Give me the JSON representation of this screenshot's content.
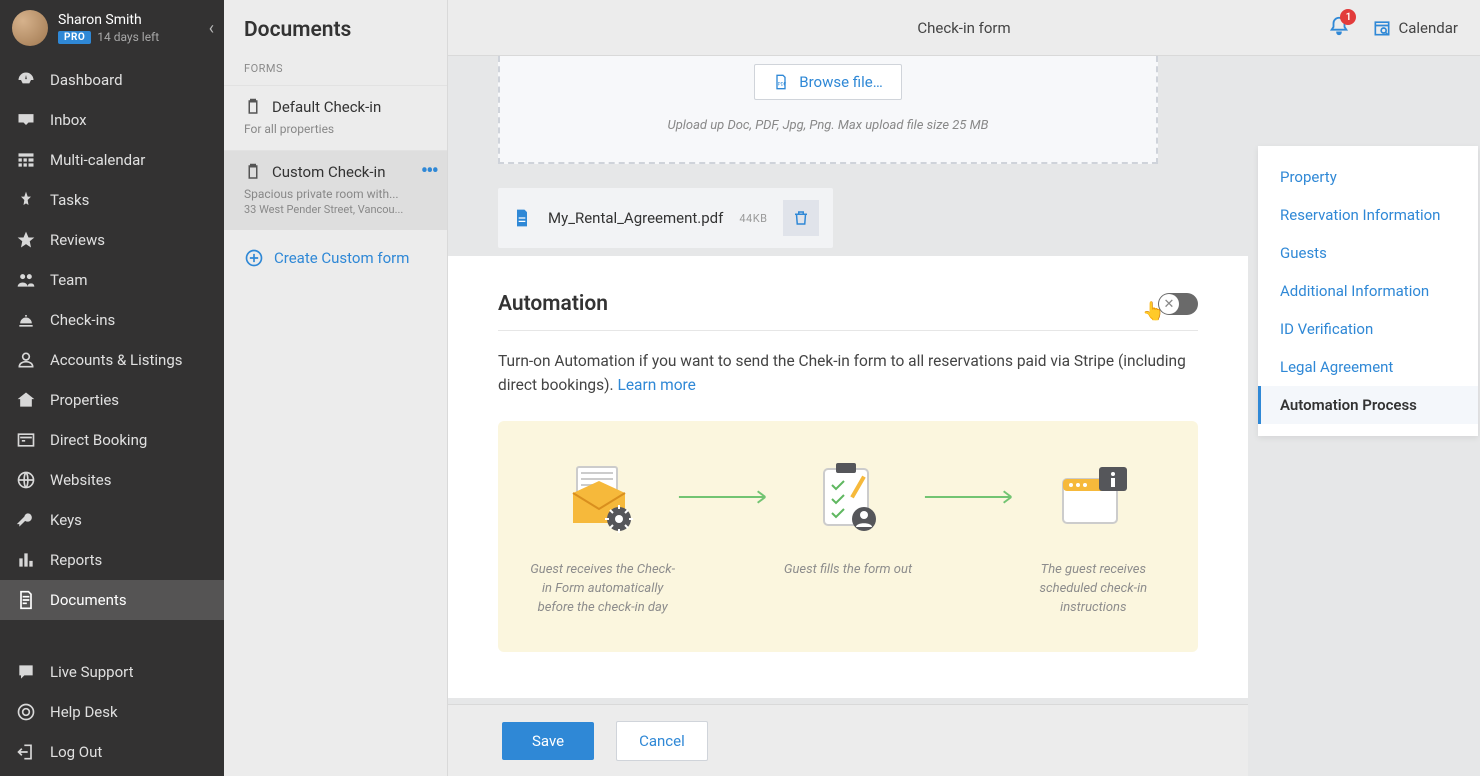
{
  "user": {
    "name": "Sharon Smith",
    "badge": "PRO",
    "days_left": "14 days left"
  },
  "nav": [
    {
      "label": "Dashboard"
    },
    {
      "label": "Inbox"
    },
    {
      "label": "Multi-calendar"
    },
    {
      "label": "Tasks"
    },
    {
      "label": "Reviews"
    },
    {
      "label": "Team"
    },
    {
      "label": "Check-ins"
    },
    {
      "label": "Accounts & Listings"
    },
    {
      "label": "Properties"
    },
    {
      "label": "Direct Booking"
    },
    {
      "label": "Websites"
    },
    {
      "label": "Keys"
    },
    {
      "label": "Reports"
    },
    {
      "label": "Documents"
    }
  ],
  "nav_bottom": [
    {
      "label": "Live Support"
    },
    {
      "label": "Help Desk"
    },
    {
      "label": "Log Out"
    }
  ],
  "panel2": {
    "title": "Documents",
    "section": "FORMS",
    "forms": [
      {
        "title": "Default Check-in",
        "sub": "For all properties"
      },
      {
        "title": "Custom Check-in",
        "sub": "Spacious private room with...",
        "sub2": "33 West Pender Street, Vancou..."
      }
    ],
    "create": "Create Custom form"
  },
  "topbar": {
    "title": "Check-in form",
    "notif_count": "1",
    "calendar": "Calendar"
  },
  "upload": {
    "browse": "Browse file…",
    "hint": "Upload up  Doc, PDF, Jpg, Png. Max upload file size 25 MB"
  },
  "file": {
    "name": "My_Rental_Agreement.pdf",
    "size": "44KB"
  },
  "automation": {
    "title": "Automation",
    "desc": "Turn-on Automation if you want to send the Chek-in form to all reservations paid via Stripe (including direct bookings). ",
    "learn": "Learn more",
    "steps": [
      "Guest receives the Check-in Form automatically before the check-in day",
      "Guest fills the form out",
      "The guest receives scheduled check-in instructions"
    ]
  },
  "footer": {
    "save": "Save",
    "cancel": "Cancel"
  },
  "rightnav": [
    "Property",
    "Reservation Information",
    "Guests",
    "Additional Information",
    "ID Verification",
    "Legal Agreement",
    "Automation Process"
  ]
}
